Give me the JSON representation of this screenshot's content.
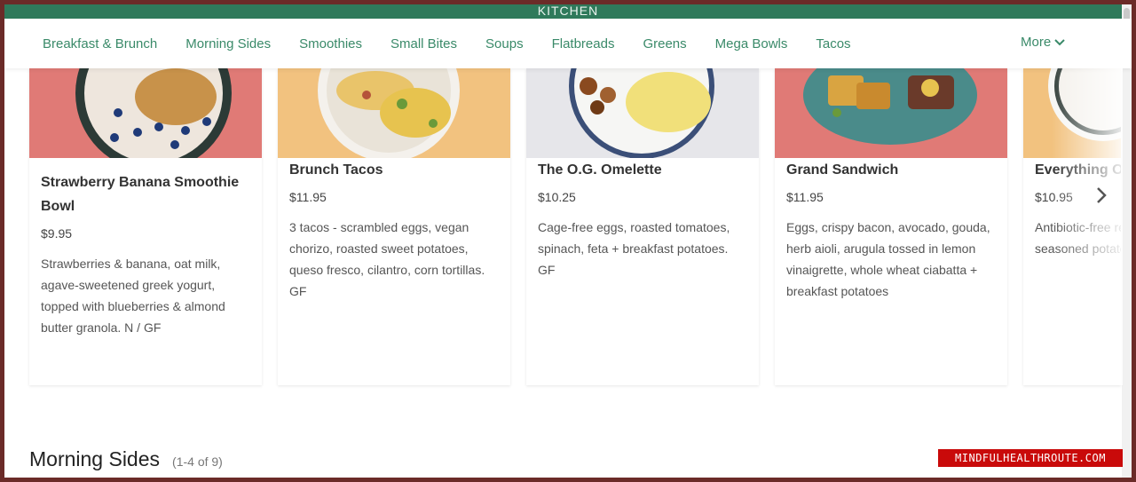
{
  "brand": {
    "text": "KITCHEN"
  },
  "nav": {
    "items": [
      "Breakfast & Brunch",
      "Morning Sides",
      "Smoothies",
      "Small Bites",
      "Soups",
      "Flatbreads",
      "Greens",
      "Mega Bowls",
      "Tacos"
    ],
    "more_label": "More"
  },
  "cards": [
    {
      "title": "Strawberry Banana Smoothie Bowl",
      "price": "$9.95",
      "description": "Strawberries & banana, oat milk, agave-sweetened greek yogurt, topped with blueberries & almond butter granola. N / GF",
      "photo_bg": "#e07a76"
    },
    {
      "title": "Brunch Tacos",
      "price": "$11.95",
      "description": "3 tacos - scrambled eggs, vegan chorizo, roasted sweet potatoes, queso fresco, cilantro, corn tortillas. GF",
      "photo_bg": "#f2c27f"
    },
    {
      "title": "The O.G. Omelette",
      "price": "$10.25",
      "description": "Cage-free eggs, roasted tomatoes, spinach, feta + breakfast potatoes. GF",
      "photo_bg": "#e6e6ea"
    },
    {
      "title": "Grand Sandwich",
      "price": "$11.95",
      "description": "Eggs, crispy bacon, avocado, gouda, herb aioli, arugula tossed in lemon vinaigrette, whole wheat ciabatta + breakfast potatoes",
      "photo_bg": "#e07a76"
    },
    {
      "title": "Everything Omelette",
      "price": "$10.95",
      "description": "Antibiotic-free red onion, peppers, seasoned potatoes, breakfast potatoes",
      "photo_bg": "#f2c27f"
    }
  ],
  "section": {
    "title": "Morning Sides",
    "count": "(1-4 of 9)"
  },
  "watermark": "MINDFULHEALTHROUTE.COM",
  "colors": {
    "brand_green": "#2f7a5b",
    "nav_text": "#3a8a69",
    "frame": "#6b2b28",
    "watermark_bg": "#c90a0a"
  },
  "icons": {
    "more": "chevron-down-icon",
    "carousel": "chevron-right-icon"
  }
}
